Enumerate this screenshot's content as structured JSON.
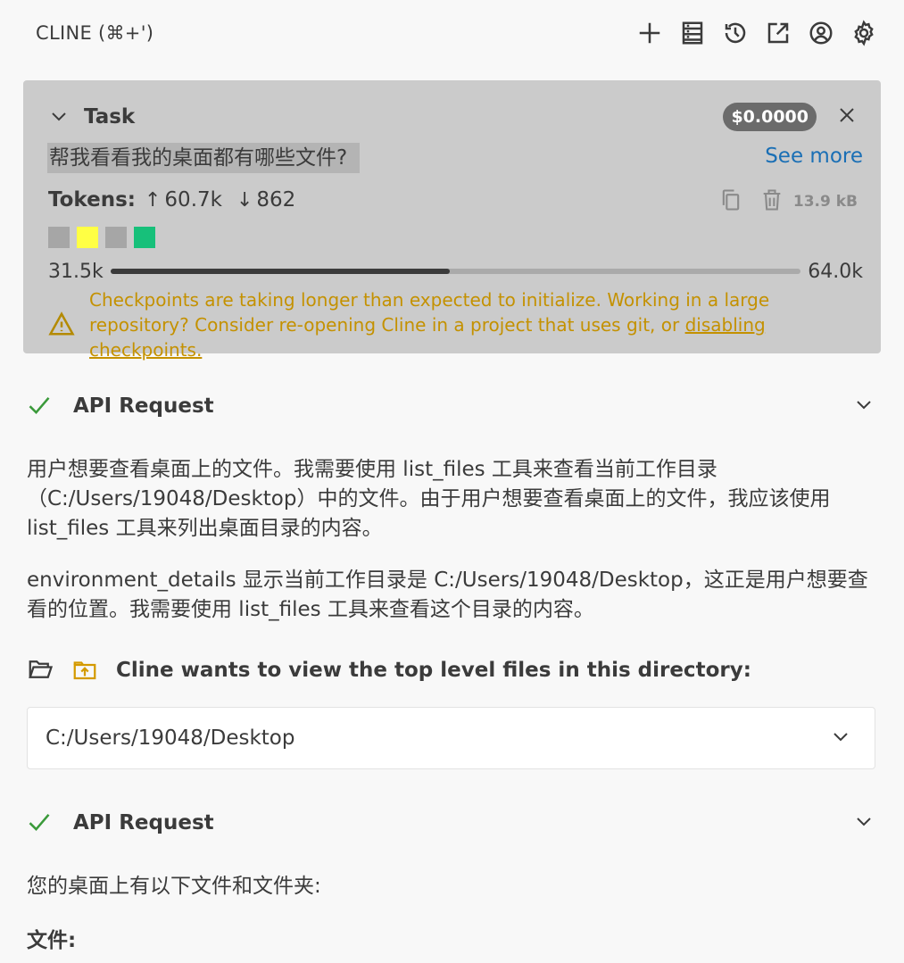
{
  "header": {
    "title": "CLINE (⌘+')",
    "actions": [
      "new-task",
      "mcp-servers",
      "history",
      "open-in-editor",
      "account",
      "settings"
    ]
  },
  "task": {
    "label": "Task",
    "cost": "$0.0000",
    "question": "帮我看看我的桌面都有哪些文件?",
    "see_more": "See more",
    "tokens_label": "Tokens:",
    "tokens_in": "60.7k",
    "tokens_out": "862",
    "size": "13.9 kB",
    "swatch_colors": [
      "#a6a6a6",
      "#ffff44",
      "#a6a6a6",
      "#17c07a"
    ],
    "context_used": "31.5k",
    "context_max": "64.0k",
    "context_fraction": 0.492,
    "warning_text": "Checkpoints are taking longer than expected to initialize. Working in a large repository? Consider re-opening Cline in a project that uses git, or ",
    "warning_link": "disabling checkpoints."
  },
  "api1": {
    "label": "API Request"
  },
  "para1": "用户想要查看桌面上的文件。我需要使用 list_files 工具来查看当前工作目录（C:/Users/19048/Desktop）中的文件。由于用户想要查看桌面上的文件，我应该使用 list_files 工具来列出桌面目录的内容。",
  "para2": "environment_details 显示当前工作目录是 C:/Users/19048/Desktop，这正是用户想要查看的位置。我需要使用 list_files 工具来查看这个目录的内容。",
  "tool": {
    "label": "Cline wants to view the top level files in this directory:"
  },
  "path": "C:/Users/19048/Desktop",
  "api2": {
    "label": "API Request"
  },
  "para3": "您的桌面上有以下文件和文件夹:",
  "heading": "文件:",
  "colors": {
    "success": "#3a9a3a",
    "warning": "#c49100",
    "link": "#1a6fb5",
    "folder": "#d49a00"
  }
}
